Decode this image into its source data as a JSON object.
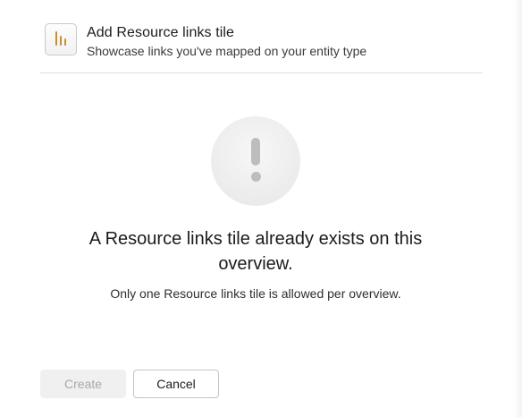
{
  "header": {
    "icon": "bar-chart-icon",
    "title": "Add Resource links tile",
    "subtitle": "Showcase links you've mapped on your entity type"
  },
  "alert": {
    "icon": "exclamation-icon",
    "message": "A Resource links tile already exists on this overview.",
    "detail": "Only one Resource links tile is allowed per overview."
  },
  "footer": {
    "create_label": "Create",
    "create_disabled": true,
    "cancel_label": "Cancel"
  },
  "colors": {
    "accent_icon": "#c5902a",
    "disabled_button_bg": "#f0f0f0",
    "disabled_button_text": "#a9a9a9",
    "alert_glyph": "#bdbdbd"
  }
}
